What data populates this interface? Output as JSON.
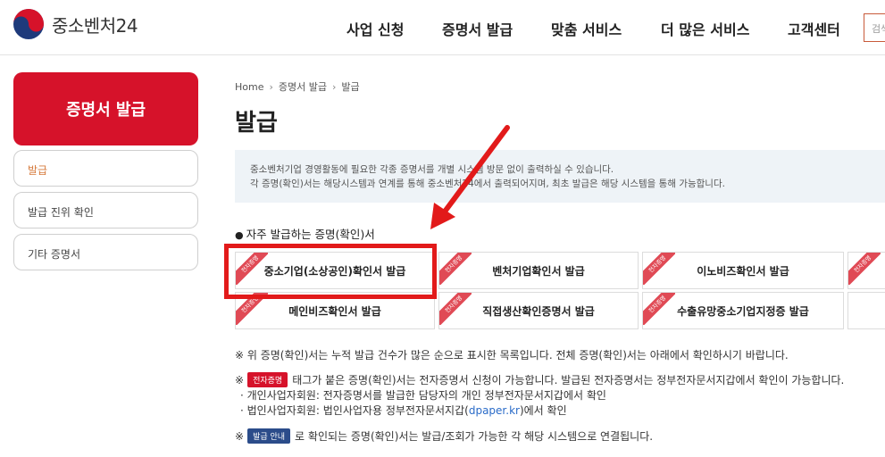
{
  "header": {
    "logo_text": "중소벤처24",
    "nav": [
      "사업 신청",
      "증명서 발급",
      "맞춤 서비스",
      "더 많은 서비스",
      "고객센터"
    ],
    "search_placeholder": "검색"
  },
  "sidebar": {
    "title": "증명서 발급",
    "items": [
      {
        "label": "발급",
        "active": true
      },
      {
        "label": "발급 진위 확인",
        "active": false
      },
      {
        "label": "기타 증명서",
        "active": false
      }
    ]
  },
  "breadcrumb": [
    "Home",
    "증명서 발급",
    "발급"
  ],
  "page_title": "발급",
  "info": {
    "line1": "중소벤처기업 경영활동에 필요한 각종 증명서를 개별 시스템 방문 없이 출력하실 수 있습니다.",
    "line2": "각 증명(확인)서는 해당시스템과 연계를 통해 중소벤처24에서 출력되어지며, 최초 발급은 해당 시스템을 통해 가능합니다."
  },
  "frequent": {
    "heading": "자주 발급하는 증명(확인)서",
    "ribbon_label": "전자증명",
    "row1": [
      "중소기업(소상공인)확인서 발급",
      "벤처기업확인서 발급",
      "이노비즈확인서 발급",
      ""
    ],
    "row2": [
      "메인비즈확인서 발급",
      "직접생산확인증명서 발급",
      "수출유망중소기업지정증 발급",
      ""
    ]
  },
  "notes": {
    "n1": "※ 위 증명(확인)서는 누적 발급 건수가 많은 순으로 표시한 목록입니다. 전체 증명(확인)서는 아래에서 확인하시기 바랍니다.",
    "n2_prefix": "※",
    "n2_tag": "전자증명",
    "n2_text": "태그가 붙은 증명(확인)서는 전자증명서 신청이 가능합니다. 발급된 전자증명서는 정부전자문서지갑에서 확인이 가능합니다.",
    "n2_sub1": "· 개인사업자회원: 전자증명서를 발급한 담당자의 개인 정부전자문서지갑에서 확인",
    "n2_sub2_pre": "· 법인사업자회원: 법인사업자용 정부전자문서지갑(",
    "n2_sub2_link": "dpaper.kr",
    "n2_sub2_post": ")에서 확인",
    "n3_prefix": "※",
    "n3_tag": "발급 안내",
    "n3_text": "로 확인되는 증명(확인)서는 발급/조회가 가능한 각 해당 시스템으로 연결됩니다."
  },
  "colors": {
    "brand_red": "#d6122a",
    "ribbon_red": "#e04a55",
    "highlight_red": "#e21a1a",
    "tag_blue": "#2b4c8a",
    "info_bg": "#eef3f7"
  }
}
